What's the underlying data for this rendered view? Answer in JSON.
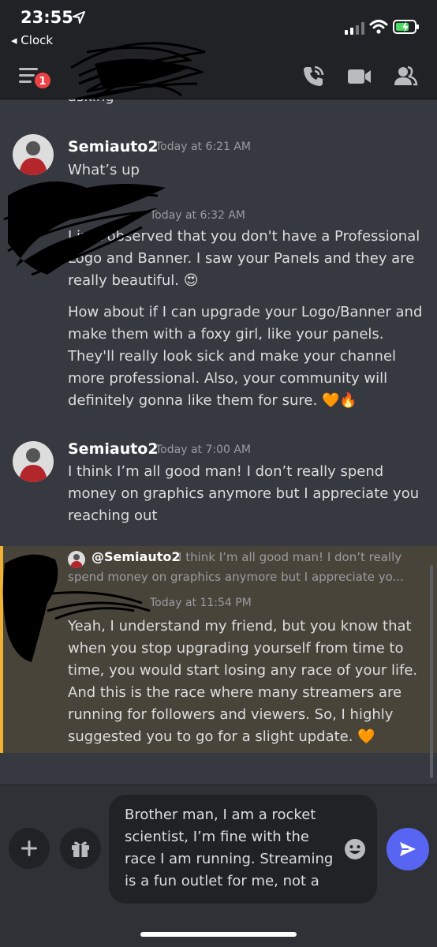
{
  "status_bar": {
    "time": "23:55",
    "back_label": "◂ Clock"
  },
  "header": {
    "badge_count": "1",
    "icons": [
      "hamburger-menu-icon",
      "phone-call-icon",
      "video-camera-icon",
      "members-icon"
    ]
  },
  "messages": {
    "partial_top": "asking",
    "msg1": {
      "username": "Semiauto2",
      "timestamp": "Today at 6:21 AM",
      "text": "What’s up"
    },
    "msg2": {
      "timestamp": "Today at 6:32 AM",
      "para1": "I just observed that you don't have a Professional Logo and Banner. I saw your Panels and they are really beautiful.",
      "para1_emoji": "😍",
      "para2": "How about if I can upgrade your Logo/Banner and make them with a foxy girl, like your panels. They'll really look sick and make your channel more professional. Also, your community will definitely gonna like them for sure.",
      "para2_emoji": "🧡🔥"
    },
    "msg3": {
      "username": "Semiauto2",
      "timestamp": "Today at 7:00 AM",
      "text": "I think I’m all good man! I don’t really spend money on graphics anymore but I appreciate you reaching out"
    },
    "msg4": {
      "reply_name": "@Semiauto2",
      "reply_line1": "I think I’m all good man! I don’t really",
      "reply_line2": "spend money on graphics anymore but I appreciate yo...",
      "timestamp": "Today at 11:54 PM",
      "text": "Yeah, I understand my friend, but you know that when you stop upgrading yourself from time to time, you would start losing any race of your life. And this is the race where many streamers are running for followers and viewers. So, I highly suggested you to go for a slight update.",
      "emoji": "🧡"
    }
  },
  "composer": {
    "draft": "Brother man, I am a rocket scientist, I’m fine with the race I am running. Streaming is a fun outlet for me, not a",
    "icons": [
      "plus-icon",
      "gift-icon",
      "emoji-icon",
      "send-icon"
    ]
  },
  "colors": {
    "accent": "#5865f2",
    "mention_bg": "#49443a",
    "mention_bar": "#f0b232",
    "badge": "#ed4245"
  }
}
